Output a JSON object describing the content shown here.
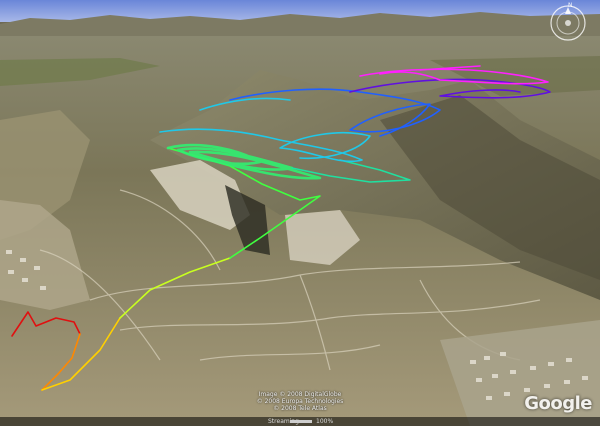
{
  "map": {
    "view_type": "3D satellite terrain with GPS flight track",
    "attribution": [
      "Image © 2008 DigitalGlobe",
      "© 2008 Europa Technologies",
      "© 2008 Tele Atlas"
    ],
    "logo": "Google",
    "status": {
      "label": "Streaming",
      "percent_label": "100%",
      "percent": 1.0
    },
    "controls": {
      "compass_icon": "compass-icon",
      "north_marker": "N"
    },
    "track_colors": [
      "#e01010",
      "#ff8800",
      "#ffe000",
      "#c8ff20",
      "#40ff40",
      "#20e0a0",
      "#20c8e8",
      "#2060ff",
      "#6010e0",
      "#c020ff",
      "#ff20ff"
    ]
  }
}
